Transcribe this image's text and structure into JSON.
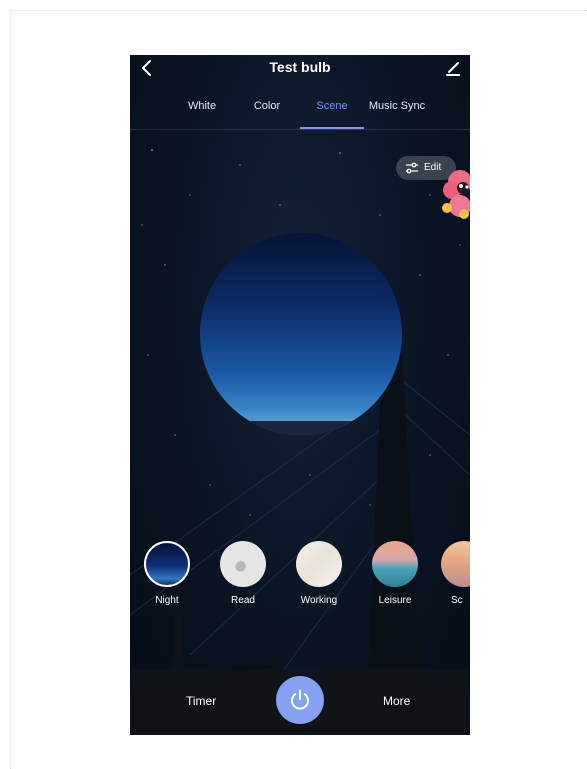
{
  "header": {
    "title": "Test bulb"
  },
  "tabs": [
    {
      "label": "White",
      "active": false
    },
    {
      "label": "Color",
      "active": false
    },
    {
      "label": "Scene",
      "active": true
    },
    {
      "label": "Music Sync",
      "active": false
    }
  ],
  "edit_button": {
    "label": "Edit"
  },
  "scenes": [
    {
      "name": "Night",
      "selected": true
    },
    {
      "name": "Read",
      "selected": false
    },
    {
      "name": "Working",
      "selected": false
    },
    {
      "name": "Leisure",
      "selected": false
    },
    {
      "name": "Sc",
      "selected": false
    }
  ],
  "bottom_bar": {
    "timer_label": "Timer",
    "more_label": "More"
  },
  "colors": {
    "accent": "#7f97f3",
    "power_button": "#86a0f2",
    "background": "#0b1627"
  },
  "icons": {
    "back": "chevron-left-icon",
    "edit": "pencil-icon",
    "sliders": "sliders-icon",
    "power": "power-icon"
  }
}
